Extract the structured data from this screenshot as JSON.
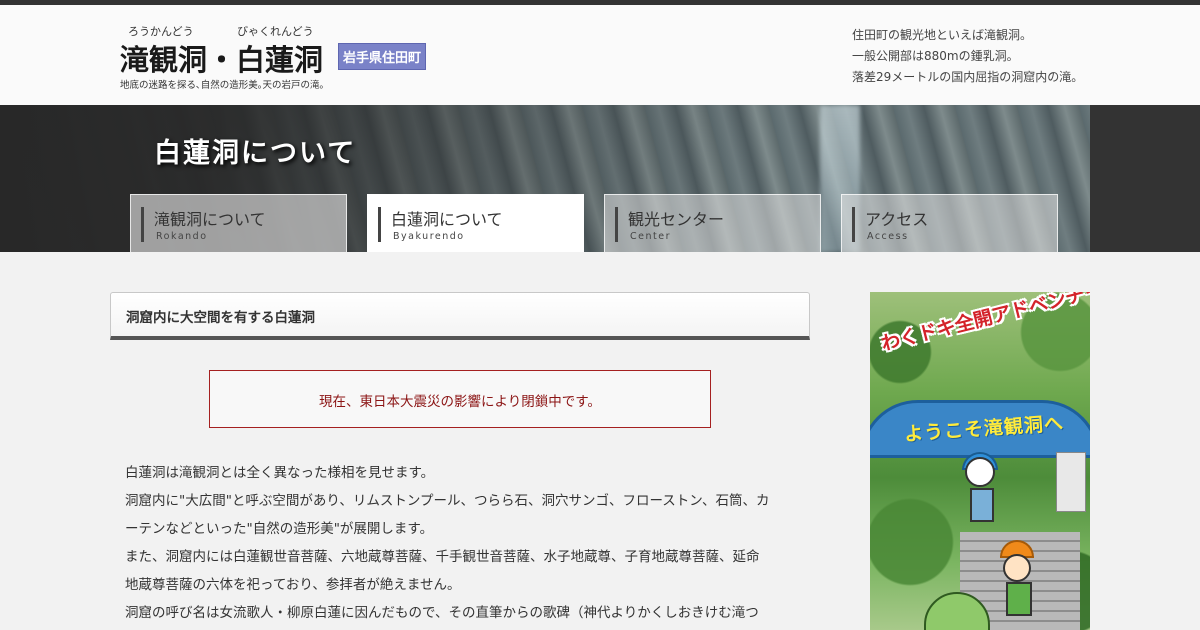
{
  "header": {
    "ruby_1": "ろうかんどう",
    "ruby_2": "びゃくれんどう",
    "title": "滝観洞・白蓮洞",
    "badge": "岩手県住田町",
    "tagline": "地底の迷路を探る､自然の造形美｡天の岩戸の滝｡",
    "info": [
      "住田町の観光地といえば滝観洞。",
      "一般公開部は880mの鍾乳洞。",
      "落差29メートルの国内屈指の洞窟内の滝。"
    ]
  },
  "hero": {
    "title": "白蓮洞について"
  },
  "nav": {
    "items": [
      {
        "label": "滝観洞について",
        "sub": "Rokando",
        "active": false
      },
      {
        "label": "白蓮洞について",
        "sub": "Byakurendo",
        "active": true
      },
      {
        "label": "観光センター",
        "sub": "Center",
        "active": false
      },
      {
        "label": "アクセス",
        "sub": "Access",
        "active": false
      }
    ]
  },
  "main": {
    "heading": "洞窟内に大空間を有する白蓮洞",
    "notice": "現在、東日本大震災の影響により閉鎖中です。",
    "paragraphs": [
      "白蓮洞は滝観洞とは全く異なった様相を見せます。",
      "洞窟内に\"大広間\"と呼ぶ空間があり、リムストンプール、つらら石、洞穴サンゴ、フローストン、石筒、カ",
      "ーテンなどといった\"自然の造形美\"が展開します。",
      "また、洞窟内には白蓮観世音菩薩、六地蔵尊菩薩、千手観世音菩薩、水子地蔵尊、子育地蔵尊菩薩、延命",
      "地蔵尊菩薩の六体を祀っており、参拝者が絶えません。",
      "洞窟の呼び名は女流歌人・柳原白蓮に因んだもので、その直筆からの歌碑（神代よりかくしおきけむ滝つ"
    ]
  },
  "ad": {
    "headline": "わくドキ全開アドベンチャー!!",
    "welcome": "ようこそ滝観洞へ"
  },
  "colors": {
    "badge": "#7a82c8",
    "notice_border": "#a52020",
    "notice_text": "#8b1414",
    "topbar": "#333333"
  }
}
